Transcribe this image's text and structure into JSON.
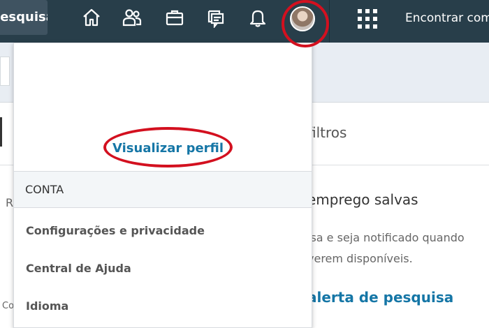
{
  "nav": {
    "search_label": "Pesquisar",
    "find_label": "Encontrar com",
    "icons": [
      "home-icon",
      "network-icon",
      "jobs-icon",
      "messaging-icon",
      "notifications-icon",
      "avatar",
      "work-grid-icon"
    ]
  },
  "colors": {
    "nav_bg": "#283e4a",
    "link_blue": "#1576a6",
    "annotation_red": "#d3101f"
  },
  "background": {
    "filters_label": "filtros",
    "saved_heading": "emprego salvas",
    "notice_line1": "isa e seja notificado quando",
    "notice_line2": "verem disponíveis.",
    "alert_link": "alerta de pesquisa",
    "left_letter": "R",
    "left_small": "Co"
  },
  "dropdown": {
    "view_profile": "Visualizar perfil",
    "section_title": "CONTA",
    "items": [
      "Configurações e privacidade",
      "Central de Ajuda",
      "Idioma"
    ]
  }
}
